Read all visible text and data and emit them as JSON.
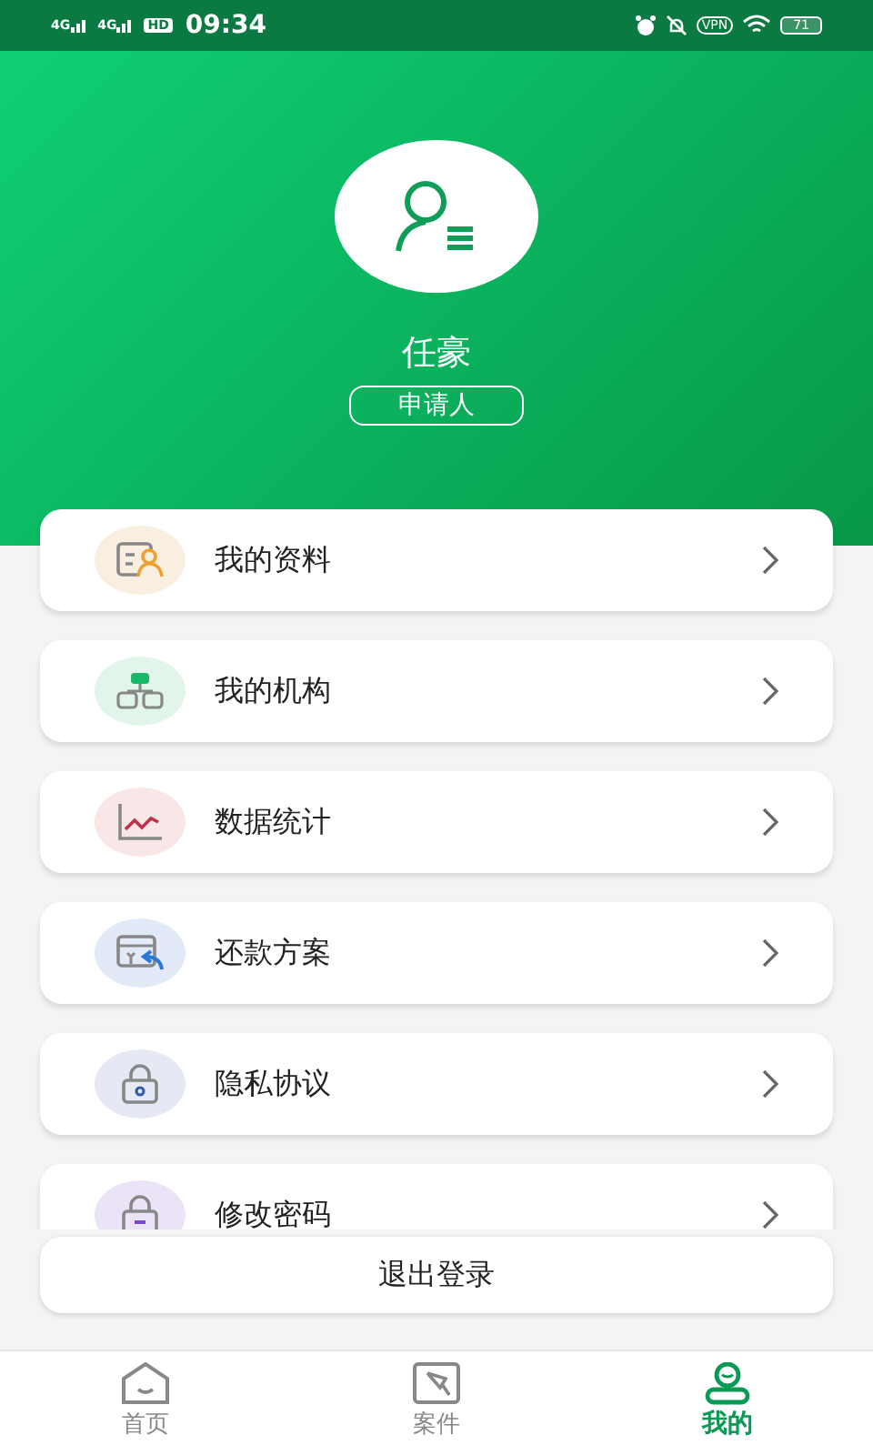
{
  "status_bar": {
    "signal_1": "4G",
    "signal_2": "4G",
    "hd": "HD",
    "time": "09:34",
    "vpn": "VPN",
    "battery": "71"
  },
  "profile": {
    "name": "任豪",
    "role": "申请人"
  },
  "menu": [
    {
      "kind": "profile",
      "label": "我的资料"
    },
    {
      "kind": "org",
      "label": "我的机构"
    },
    {
      "kind": "stats",
      "label": "数据统计"
    },
    {
      "kind": "repay",
      "label": "还款方案"
    },
    {
      "kind": "privacy",
      "label": "隐私协议"
    },
    {
      "kind": "password",
      "label": "修改密码"
    }
  ],
  "logout": "退出登录",
  "tabs": [
    {
      "kind": "home",
      "label": "首页",
      "selected": false
    },
    {
      "kind": "case",
      "label": "案件",
      "selected": false
    },
    {
      "kind": "me",
      "label": "我的",
      "selected": true
    }
  ]
}
